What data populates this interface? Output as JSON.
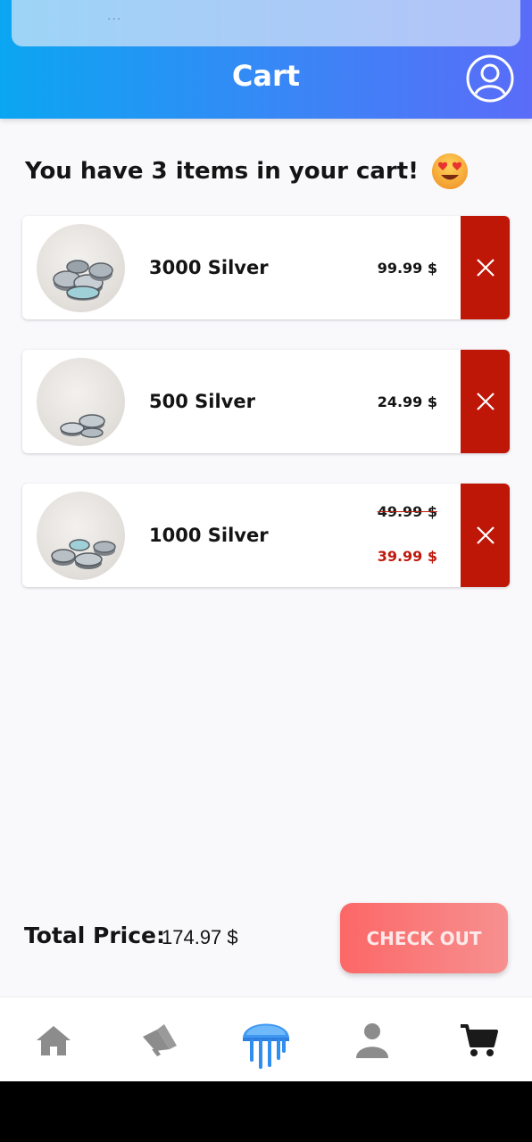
{
  "status": {
    "dots": "···"
  },
  "header": {
    "title": "Cart"
  },
  "cart": {
    "heading": "You have 3 items in your cart!",
    "emoji": "heart-eyes-emoji",
    "items": [
      {
        "name": "3000 Silver",
        "price": "99.99 $"
      },
      {
        "name": "500 Silver",
        "price": "24.99 $"
      },
      {
        "name": "1000 Silver",
        "old_price": "49.99 $",
        "price": "39.99 $"
      }
    ]
  },
  "footer": {
    "total_label": "Total Price:",
    "total_value": "174.97 $",
    "checkout_label": "CHECK OUT"
  },
  "nav": {
    "items": [
      "home-icon",
      "megaphone-icon",
      "jellyfish-logo-icon",
      "person-icon",
      "cart-icon"
    ],
    "active": "cart-icon"
  },
  "colors": {
    "header_start": "#0ba6f2",
    "header_end": "#5a6cf8",
    "remove_red": "#bf1707",
    "checkout_start": "#fc6767",
    "checkout_end": "#f79090",
    "sale_red": "#c01a0c"
  }
}
